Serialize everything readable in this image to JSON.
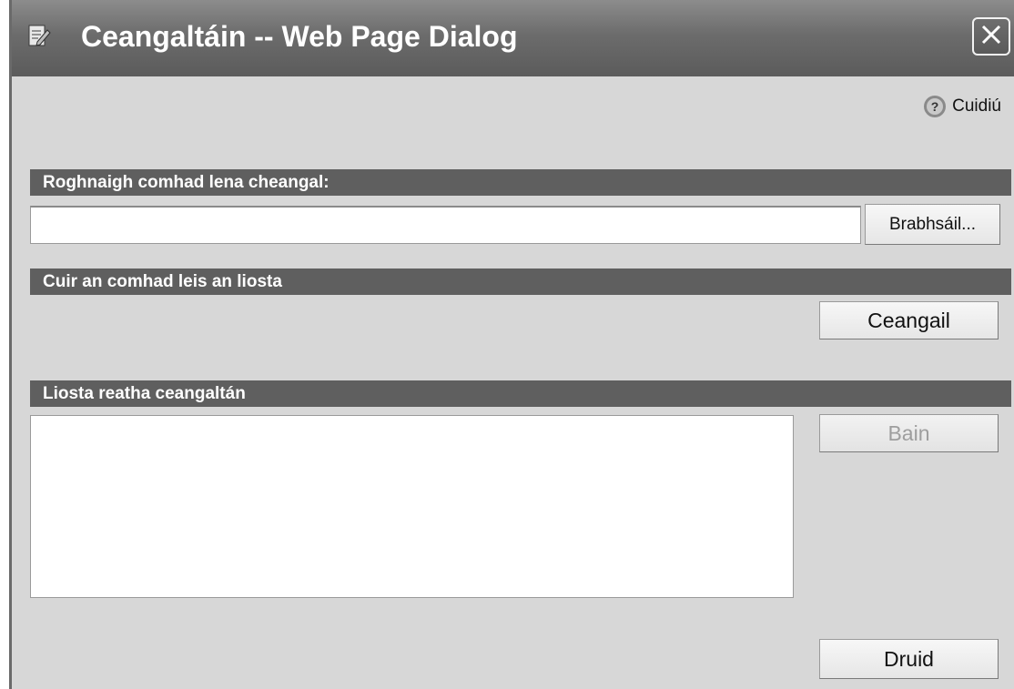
{
  "window": {
    "title": "Ceangaltáin -- Web Page Dialog",
    "icon": "page-edit-icon",
    "close_icon": "close-x-icon"
  },
  "help": {
    "label": "Cuidiú",
    "icon": "question-circle-icon"
  },
  "sections": {
    "choose_file": "Roghnaigh comhad lena cheangal:",
    "add_to_list": "Cuir an comhad leis an liosta",
    "current_list": "Liosta reatha ceangaltán"
  },
  "file_input": {
    "value": "",
    "placeholder": ""
  },
  "buttons": {
    "browse": "Brabhsáil...",
    "attach": "Ceangail",
    "remove": "Bain",
    "close": "Druid"
  },
  "attachments": [],
  "colors": {
    "dialog_bg": "#d7d7d7",
    "section_bar": "#5f5f5f",
    "disabled_text": "#9e9e9e"
  }
}
